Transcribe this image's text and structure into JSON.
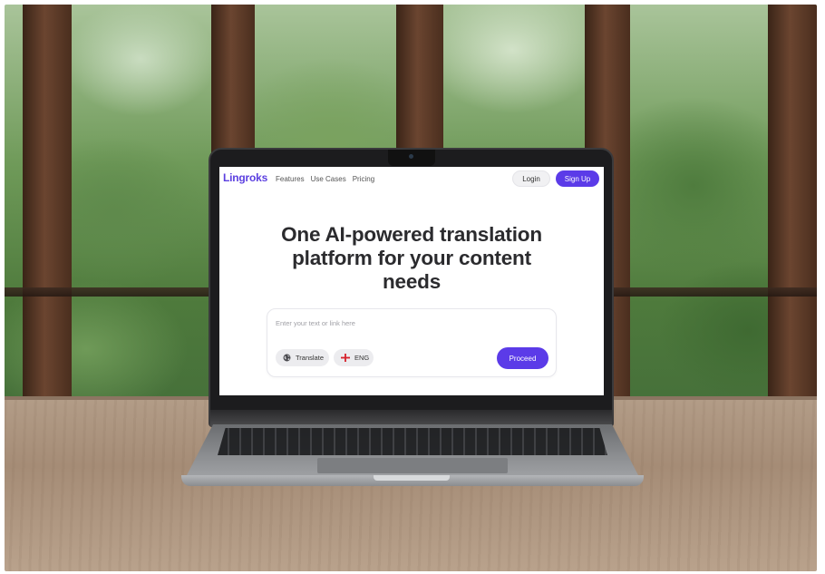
{
  "brand": {
    "name": "Lingroks",
    "accent_color": "#5b3be8"
  },
  "nav": {
    "links": [
      "Features",
      "Use Cases",
      "Pricing"
    ],
    "login_label": "Login",
    "signup_label": "Sign Up"
  },
  "hero": {
    "line1": "One AI-powered translation",
    "line2": "platform for your content",
    "line3": "needs"
  },
  "composer": {
    "placeholder": "Enter your text or link here",
    "value": "",
    "mode_chip": {
      "label": "Translate",
      "icon": "globe-icon"
    },
    "language_chip": {
      "label": "ENG",
      "icon": "england-flag-icon"
    },
    "submit_label": "Proceed"
  }
}
